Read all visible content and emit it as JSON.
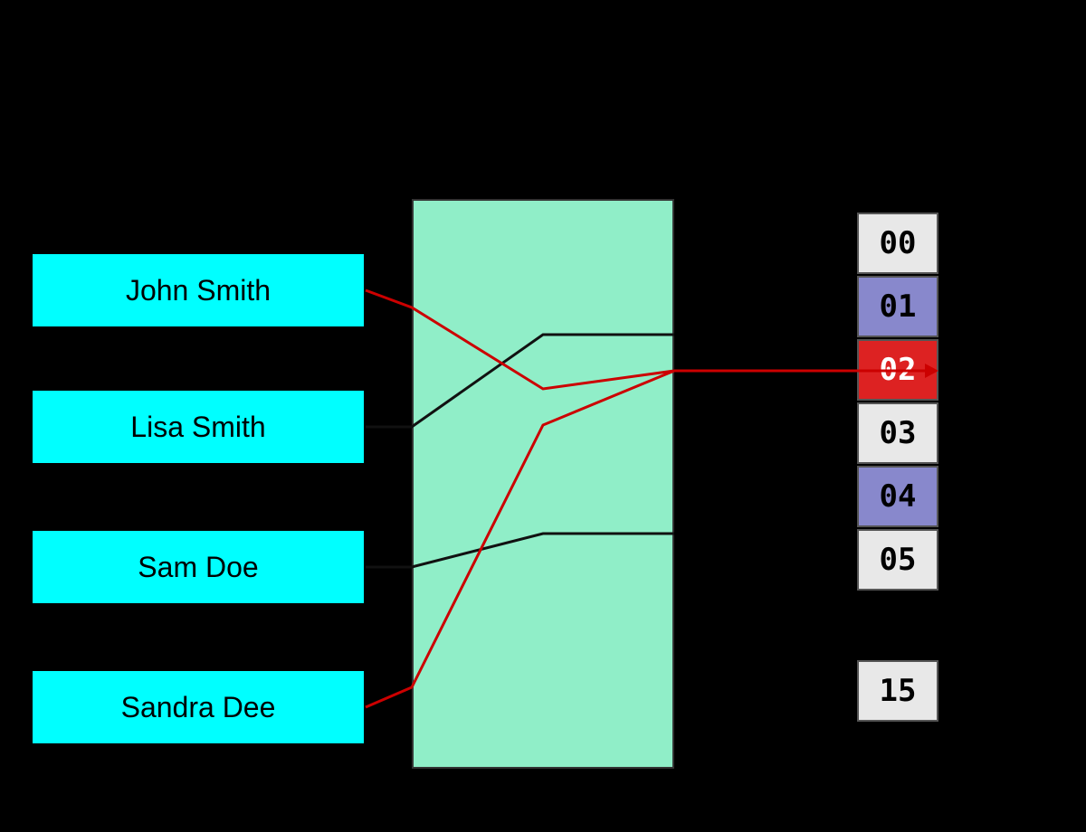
{
  "names": [
    {
      "id": "john",
      "label": "John Smith"
    },
    {
      "id": "lisa",
      "label": "Lisa Smith"
    },
    {
      "id": "sam",
      "label": "Sam Doe"
    },
    {
      "id": "sandra",
      "label": "Sandra Dee"
    }
  ],
  "slots": [
    {
      "id": "00",
      "value": "00",
      "style": "slot-white"
    },
    {
      "id": "01",
      "value": "01",
      "style": "slot-purple"
    },
    {
      "id": "02",
      "value": "02",
      "style": "slot-red"
    },
    {
      "id": "03",
      "value": "03",
      "style": "slot-white"
    },
    {
      "id": "04",
      "value": "04",
      "style": "slot-purple"
    },
    {
      "id": "05",
      "value": "05",
      "style": "slot-white"
    },
    {
      "id": "15",
      "value": "15",
      "style": "slot-white"
    }
  ],
  "colors": {
    "background": "#000000",
    "namebox_fill": "#00ffff",
    "hashbox_fill": "#90EEC8",
    "red_line": "#cc0000",
    "black_line": "#000000"
  }
}
